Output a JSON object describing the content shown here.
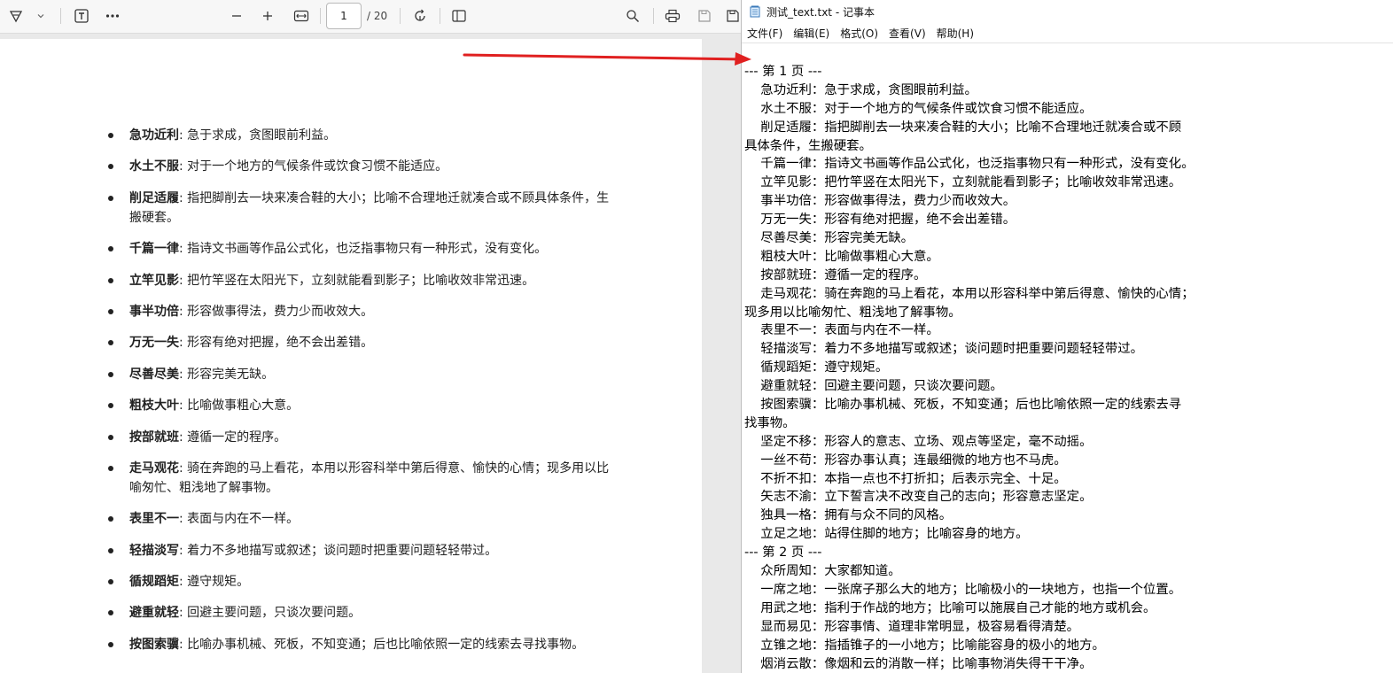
{
  "pdf_viewer": {
    "page_current": "1",
    "page_total": "/ 20",
    "toolbar_icons": [
      "draw-icon",
      "chevron-down-icon",
      "text-box-icon",
      "more-icon",
      "zoom-out-icon",
      "zoom-in-icon",
      "fit-width-icon",
      "rotate-icon",
      "page-view-icon",
      "search-icon",
      "print-icon",
      "save-icon",
      "save-as-icon"
    ],
    "items": [
      {
        "term": "急功近利",
        "text": ": 急于求成，贪图眼前利益。"
      },
      {
        "term": "水土不服",
        "text": ": 对于一个地方的气候条件或饮食习惯不能适应。"
      },
      {
        "term": "削足适履",
        "text": ": 指把脚削去一块来凑合鞋的大小；比喻不合理地迁就凑合或不顾具体条件，生搬硬套。"
      },
      {
        "term": "千篇一律",
        "text": ": 指诗文书画等作品公式化，也泛指事物只有一种形式，没有变化。"
      },
      {
        "term": "立竿见影",
        "text": ": 把竹竿竖在太阳光下，立刻就能看到影子；比喻收效非常迅速。"
      },
      {
        "term": "事半功倍",
        "text": ": 形容做事得法，费力少而收效大。"
      },
      {
        "term": "万无一失",
        "text": ": 形容有绝对把握，绝不会出差错。"
      },
      {
        "term": "尽善尽美",
        "text": ": 形容完美无缺。"
      },
      {
        "term": "粗枝大叶",
        "text": ": 比喻做事粗心大意。"
      },
      {
        "term": "按部就班",
        "text": ": 遵循一定的程序。"
      },
      {
        "term": "走马观花",
        "text": ": 骑在奔跑的马上看花，本用以形容科举中第后得意、愉快的心情；现多用以比喻匆忙、粗浅地了解事物。"
      },
      {
        "term": "表里不一",
        "text": ": 表面与内在不一样。"
      },
      {
        "term": "轻描淡写",
        "text": ": 着力不多地描写或叙述；谈问题时把重要问题轻轻带过。"
      },
      {
        "term": "循规蹈矩",
        "text": ": 遵守规矩。"
      },
      {
        "term": "避重就轻",
        "text": ": 回避主要问题，只谈次要问题。"
      },
      {
        "term": "按图索骥",
        "text": ": 比喻办事机械、死板，不知变通；后也比喻依照一定的线索去寻找事物。"
      }
    ]
  },
  "annotation": {
    "arrow_color": "#e02020"
  },
  "notepad": {
    "title": "测试_text.txt - 记事本",
    "menu": [
      "文件(F)",
      "编辑(E)",
      "格式(O)",
      "查看(V)",
      "帮助(H)"
    ],
    "lines": [
      "--- 第 1 页 ---",
      "    急功近利：急于求成，贪图眼前利益。",
      "    水土不服：对于一个地方的气候条件或饮食习惯不能适应。",
      "    削足适履：指把脚削去一块来凑合鞋的大小；比喻不合理地迁就凑合或不顾",
      "具体条件，生搬硬套。",
      "    千篇一律：指诗文书画等作品公式化，也泛指事物只有一种形式，没有变化。",
      "    立竿见影：把竹竿竖在太阳光下，立刻就能看到影子；比喻收效非常迅速。",
      "    事半功倍：形容做事得法，费力少而收效大。",
      "    万无一失：形容有绝对把握，绝不会出差错。",
      "    尽善尽美：形容完美无缺。",
      "    粗枝大叶：比喻做事粗心大意。",
      "    按部就班：遵循一定的程序。",
      "    走马观花：骑在奔跑的马上看花，本用以形容科举中第后得意、愉快的心情；",
      "现多用以比喻匆忙、粗浅地了解事物。",
      "    表里不一：表面与内在不一样。",
      "    轻描淡写：着力不多地描写或叙述；谈问题时把重要问题轻轻带过。",
      "    循规蹈矩：遵守规矩。",
      "    避重就轻：回避主要问题，只谈次要问题。",
      "    按图索骥：比喻办事机械、死板，不知变通；后也比喻依照一定的线索去寻",
      "找事物。",
      "    坚定不移：形容人的意志、立场、观点等坚定，毫不动摇。",
      "    一丝不苟：形容办事认真；连最细微的地方也不马虎。",
      "    不折不扣：本指一点也不打折扣；后表示完全、十足。",
      "    矢志不渝：立下誓言决不改变自己的志向；形容意志坚定。",
      "    独具一格：拥有与众不同的风格。",
      "    立足之地：站得住脚的地方；比喻容身的地方。",
      "--- 第 2 页 ---",
      "    众所周知：大家都知道。",
      "    一席之地：一张席子那么大的地方；比喻极小的一块地方，也指一个位置。",
      "    用武之地：指利于作战的地方；比喻可以施展自己才能的地方或机会。",
      "    显而易见：形容事情、道理非常明显，极容易看得清楚。",
      "    立锥之地：指插锥子的一小地方；比喻能容身的极小的地方。",
      "    烟消云散：像烟和云的消散一样；比喻事物消失得干干净。"
    ]
  }
}
